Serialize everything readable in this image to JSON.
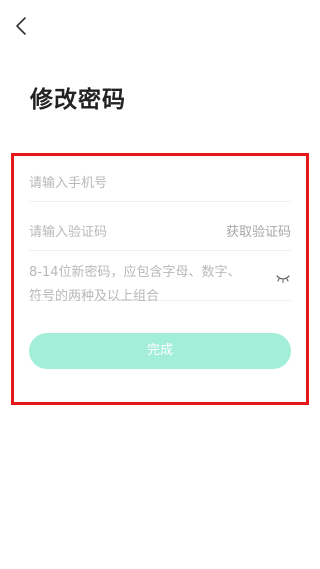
{
  "header": {
    "back_icon": "chevron-left-icon",
    "title": "修改密码"
  },
  "form": {
    "phone_placeholder": "请输入手机号",
    "code_placeholder": "请输入验证码",
    "get_code_label": "获取验证码",
    "password_placeholder_line1": "8-14位新密码，应包含字母、数字、",
    "password_placeholder_line2": "符号的两种及以上组合",
    "password_toggle_icon": "eye-closed-icon",
    "submit_label": "完成"
  },
  "colors": {
    "accent": "#a2eed9",
    "highlight": "#e8161b"
  }
}
